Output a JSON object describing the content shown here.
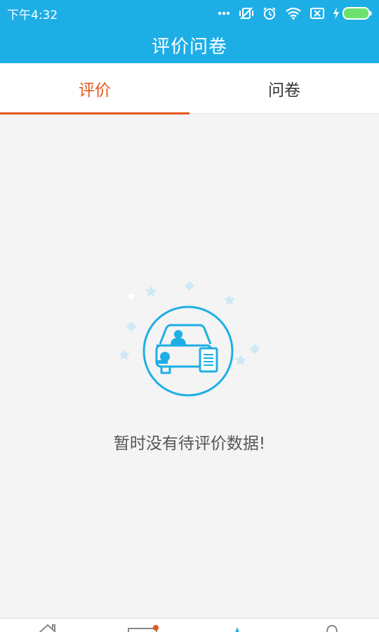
{
  "status_bar": {
    "time": "下午4:32",
    "icons": [
      "more-dots-icon",
      "vibrate-off-icon",
      "alarm-icon",
      "wifi-icon",
      "sim-off-icon",
      "charging-icon",
      "battery-icon"
    ]
  },
  "header": {
    "title": "评价问卷"
  },
  "tabs": [
    {
      "label": "评价",
      "active": true
    },
    {
      "label": "问卷",
      "active": false
    }
  ],
  "empty_state": {
    "message": "暂时没有待评价数据!",
    "icon": "car-evaluation-icon"
  },
  "bottom_nav": {
    "items": [
      "home-icon",
      "card-icon",
      "navigate-icon",
      "profile-icon"
    ],
    "badge_on": "card-icon"
  },
  "colors": {
    "primary": "#1eaee6",
    "accent": "#e4571e",
    "background": "#f4f4f4",
    "text": "#555555"
  }
}
